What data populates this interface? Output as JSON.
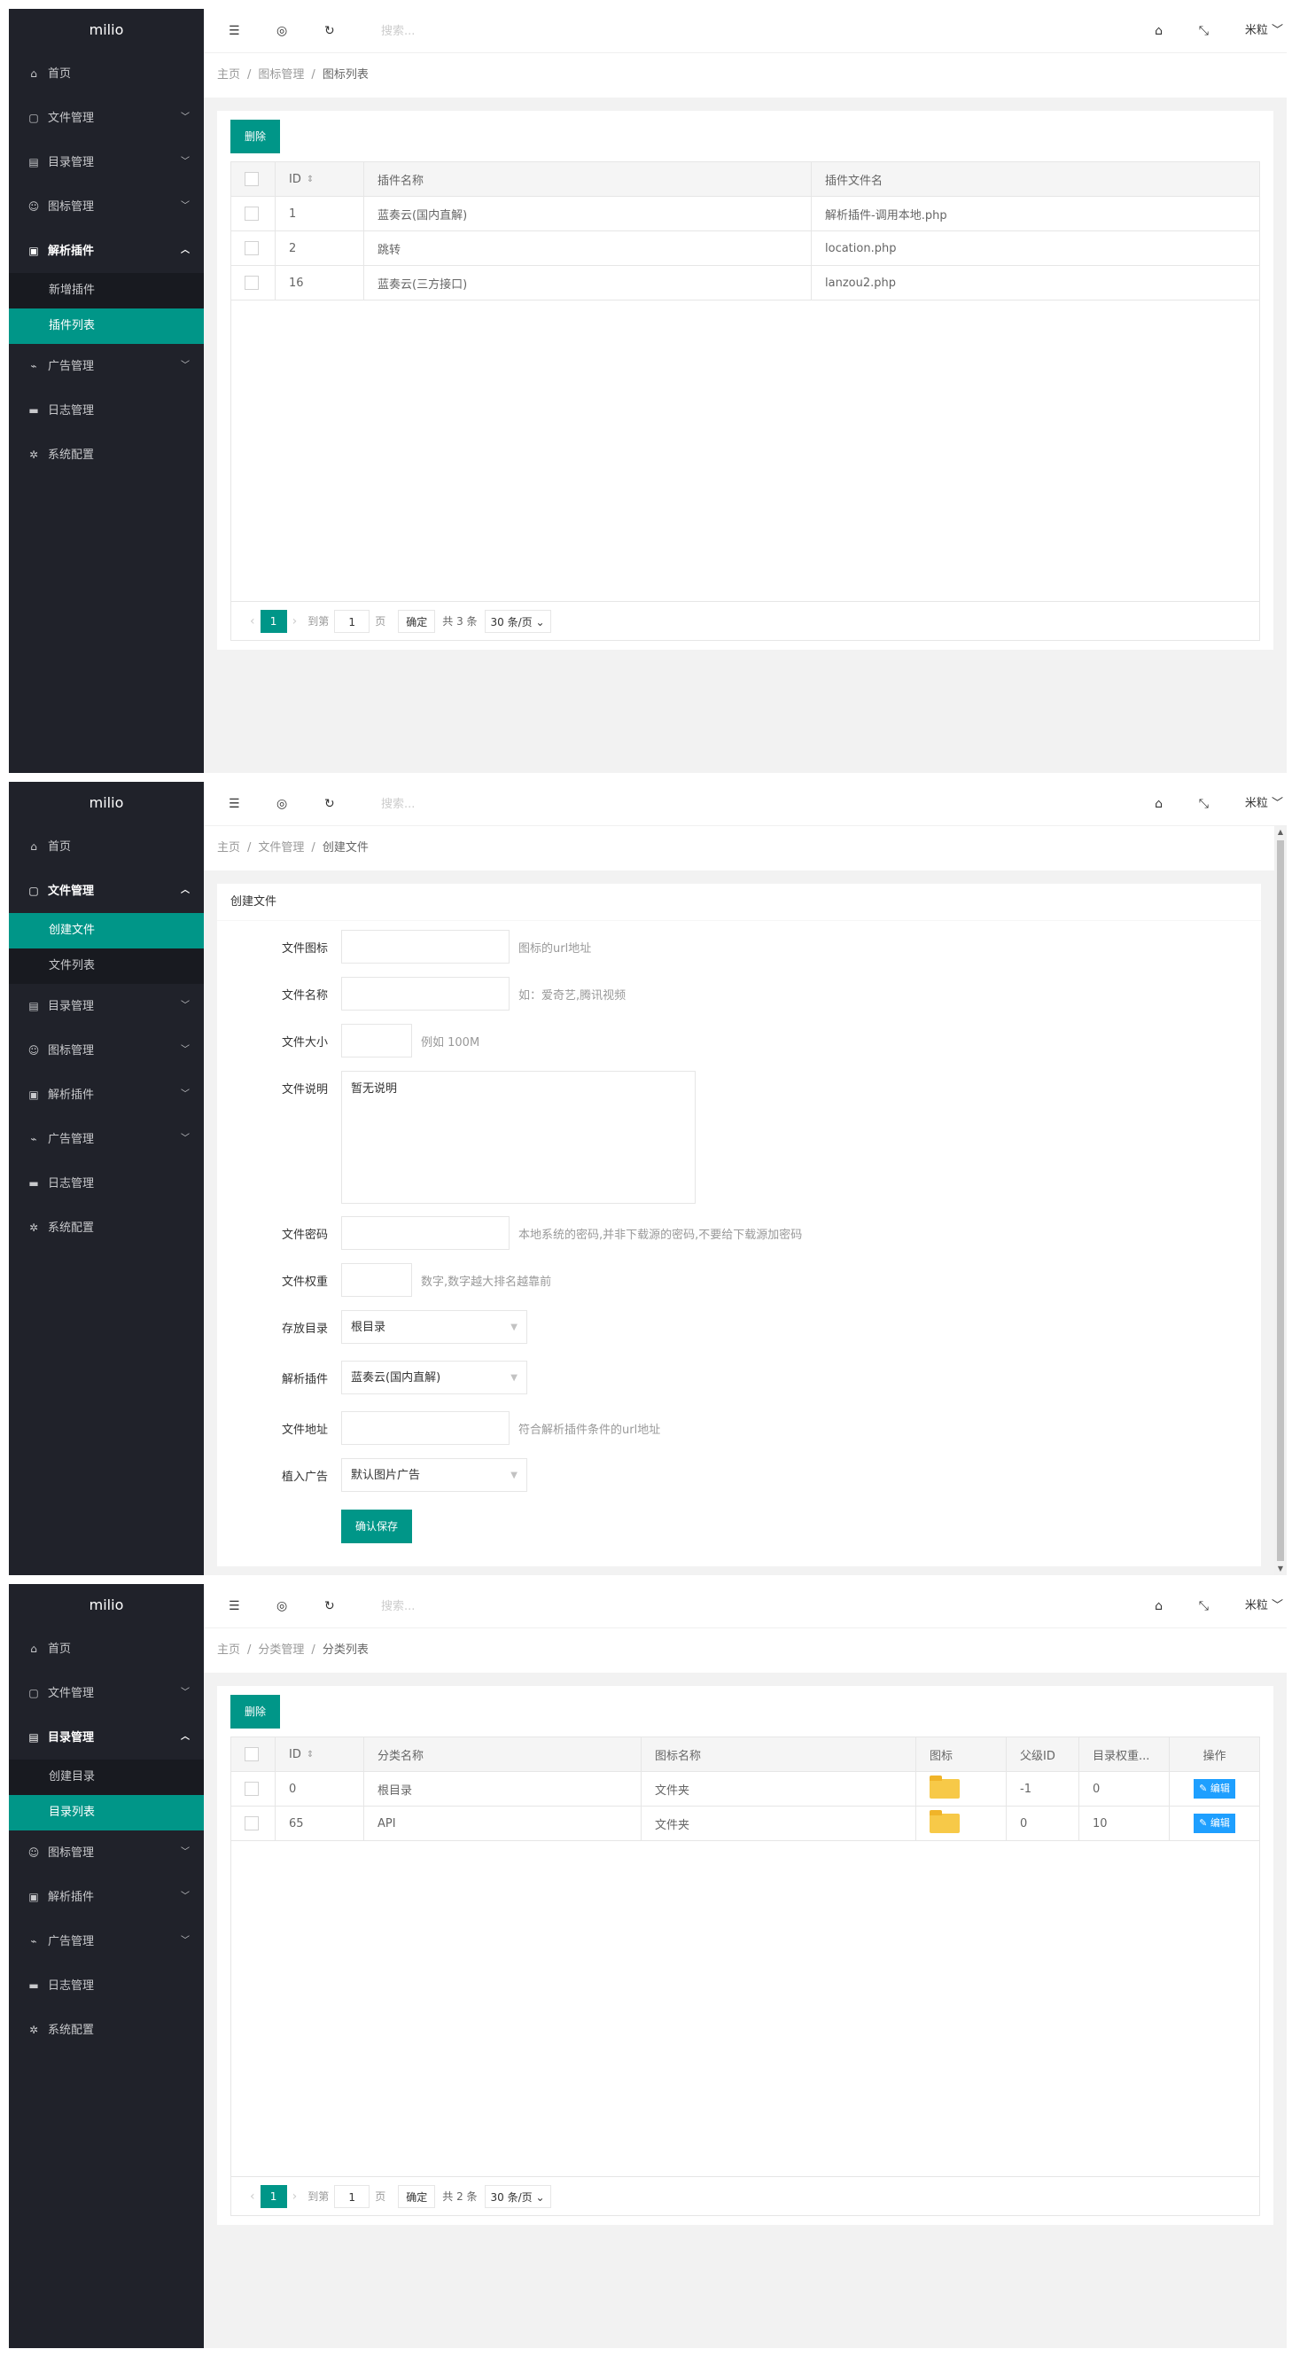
{
  "logo": "milio",
  "topbar": {
    "search_placeholder": "搜索...",
    "user": "米粒"
  },
  "sidebar": {
    "home": "首页",
    "file_mgmt": "文件管理",
    "dir_mgmt": "目录管理",
    "icon_mgmt": "图标管理",
    "parser": "解析插件",
    "ads": "广告管理",
    "logs": "日志管理",
    "config": "系统配置"
  },
  "panel1": {
    "breadcrumb": [
      "主页",
      "图标管理",
      "图标列表"
    ],
    "sub_items": [
      "新增插件",
      "插件列表"
    ],
    "delete_label": "删除",
    "columns": [
      "ID",
      "插件名称",
      "插件文件名"
    ],
    "rows": [
      {
        "id": "1",
        "name": "蓝奏云(国内直解)",
        "file": "解析插件-调用本地.php"
      },
      {
        "id": "2",
        "name": "跳转",
        "file": "location.php"
      },
      {
        "id": "16",
        "name": "蓝奏云(三方接口)",
        "file": "lanzou2.php"
      }
    ],
    "pager": {
      "page": "1",
      "goto": "到第",
      "input": "1",
      "page_unit": "页",
      "confirm": "确定",
      "total": "共 3 条",
      "per_page": "30 条/页"
    }
  },
  "panel2": {
    "breadcrumb": [
      "主页",
      "文件管理",
      "创建文件"
    ],
    "sub_items": [
      "创建文件",
      "文件列表"
    ],
    "card_title": "创建文件",
    "fields": {
      "icon": {
        "label": "文件图标",
        "hint": "图标的url地址"
      },
      "name": {
        "label": "文件名称",
        "hint": "如：爱奇艺,腾讯视频"
      },
      "size": {
        "label": "文件大小",
        "hint": "例如 100M"
      },
      "desc": {
        "label": "文件说明",
        "value": "暂无说明"
      },
      "password": {
        "label": "文件密码",
        "hint": "本地系统的密码,并非下载源的密码,不要给下载源加密码"
      },
      "weight": {
        "label": "文件权重",
        "hint": "数字,数字越大排名越靠前"
      },
      "dir": {
        "label": "存放目录",
        "value": "根目录"
      },
      "parser": {
        "label": "解析插件",
        "value": "蓝奏云(国内直解)"
      },
      "url": {
        "label": "文件地址",
        "hint": "符合解析插件条件的url地址"
      },
      "ad": {
        "label": "植入广告",
        "value": "默认图片广告"
      }
    },
    "save_label": "确认保存"
  },
  "panel3": {
    "breadcrumb": [
      "主页",
      "分类管理",
      "分类列表"
    ],
    "sub_items": [
      "创建目录",
      "目录列表"
    ],
    "delete_label": "删除",
    "columns": [
      "ID",
      "分类名称",
      "图标名称",
      "图标",
      "父级ID",
      "目录权重...",
      "操作"
    ],
    "rows": [
      {
        "id": "0",
        "name": "根目录",
        "icon_name": "文件夹",
        "parent": "-1",
        "weight": "0",
        "action": "编辑"
      },
      {
        "id": "65",
        "name": "API",
        "icon_name": "文件夹",
        "parent": "0",
        "weight": "10",
        "action": "编辑"
      }
    ],
    "pager": {
      "page": "1",
      "goto": "到第",
      "input": "1",
      "page_unit": "页",
      "confirm": "确定",
      "total": "共 2 条",
      "per_page": "30 条/页"
    }
  },
  "colors": {
    "accent": "#009688",
    "sidebar": "#20222a",
    "edit": "#1e9fff",
    "folder": "#f7c948"
  }
}
